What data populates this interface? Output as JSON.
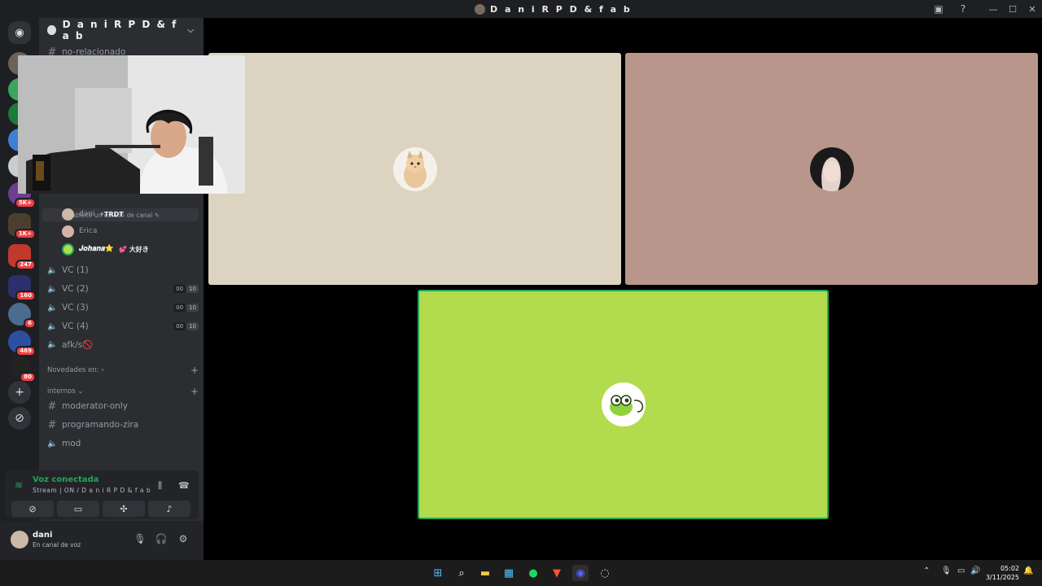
{
  "window": {
    "title": "D a n i R P D & f a b",
    "min_glyph": "—",
    "max_glyph": "☐",
    "close_glyph": "✕"
  },
  "server": {
    "name": "D a n i R P D & f a b",
    "top_channel": "no-relacionado",
    "status_prompt": "Establece un estado de canal"
  },
  "members": [
    {
      "name": "dani",
      "tag": "⚡TRDT"
    },
    {
      "name": "Erica",
      "tag": ""
    },
    {
      "name": "𝑱𝒐𝒉𝒂𝒏𝒂⭐",
      "tag": "💕 大好き"
    }
  ],
  "voice_channels": [
    {
      "name": "VC (1)",
      "count": "",
      "limit": ""
    },
    {
      "name": "VC (2)",
      "count": "00",
      "limit": "10"
    },
    {
      "name": "VC (3)",
      "count": "00",
      "limit": "10"
    },
    {
      "name": "VC (4)",
      "count": "00",
      "limit": "10"
    },
    {
      "name": "afk/s🚫",
      "count": "",
      "limit": ""
    }
  ],
  "categories": {
    "news": "Novedades en:",
    "internal": "internos"
  },
  "internal_channels": [
    "moderator-only",
    "programando-zira",
    "mod"
  ],
  "voice_panel": {
    "title": "Voz conectada",
    "subtitle": "Stream | ON / D a n i R P D & f a b"
  },
  "user": {
    "name": "dani",
    "status": "En canal de voz"
  },
  "guild_badges": [
    "5K+",
    "1K+",
    "247",
    "160",
    "6",
    "469",
    "80"
  ],
  "clock": {
    "time": "05:02",
    "date": "3/11/2025"
  },
  "colors": {
    "accent_green": "#23a55a",
    "tile_cat": "#dcd3c1",
    "tile_pink": "#b8968b",
    "tile_lime": "#b2dc4d"
  }
}
